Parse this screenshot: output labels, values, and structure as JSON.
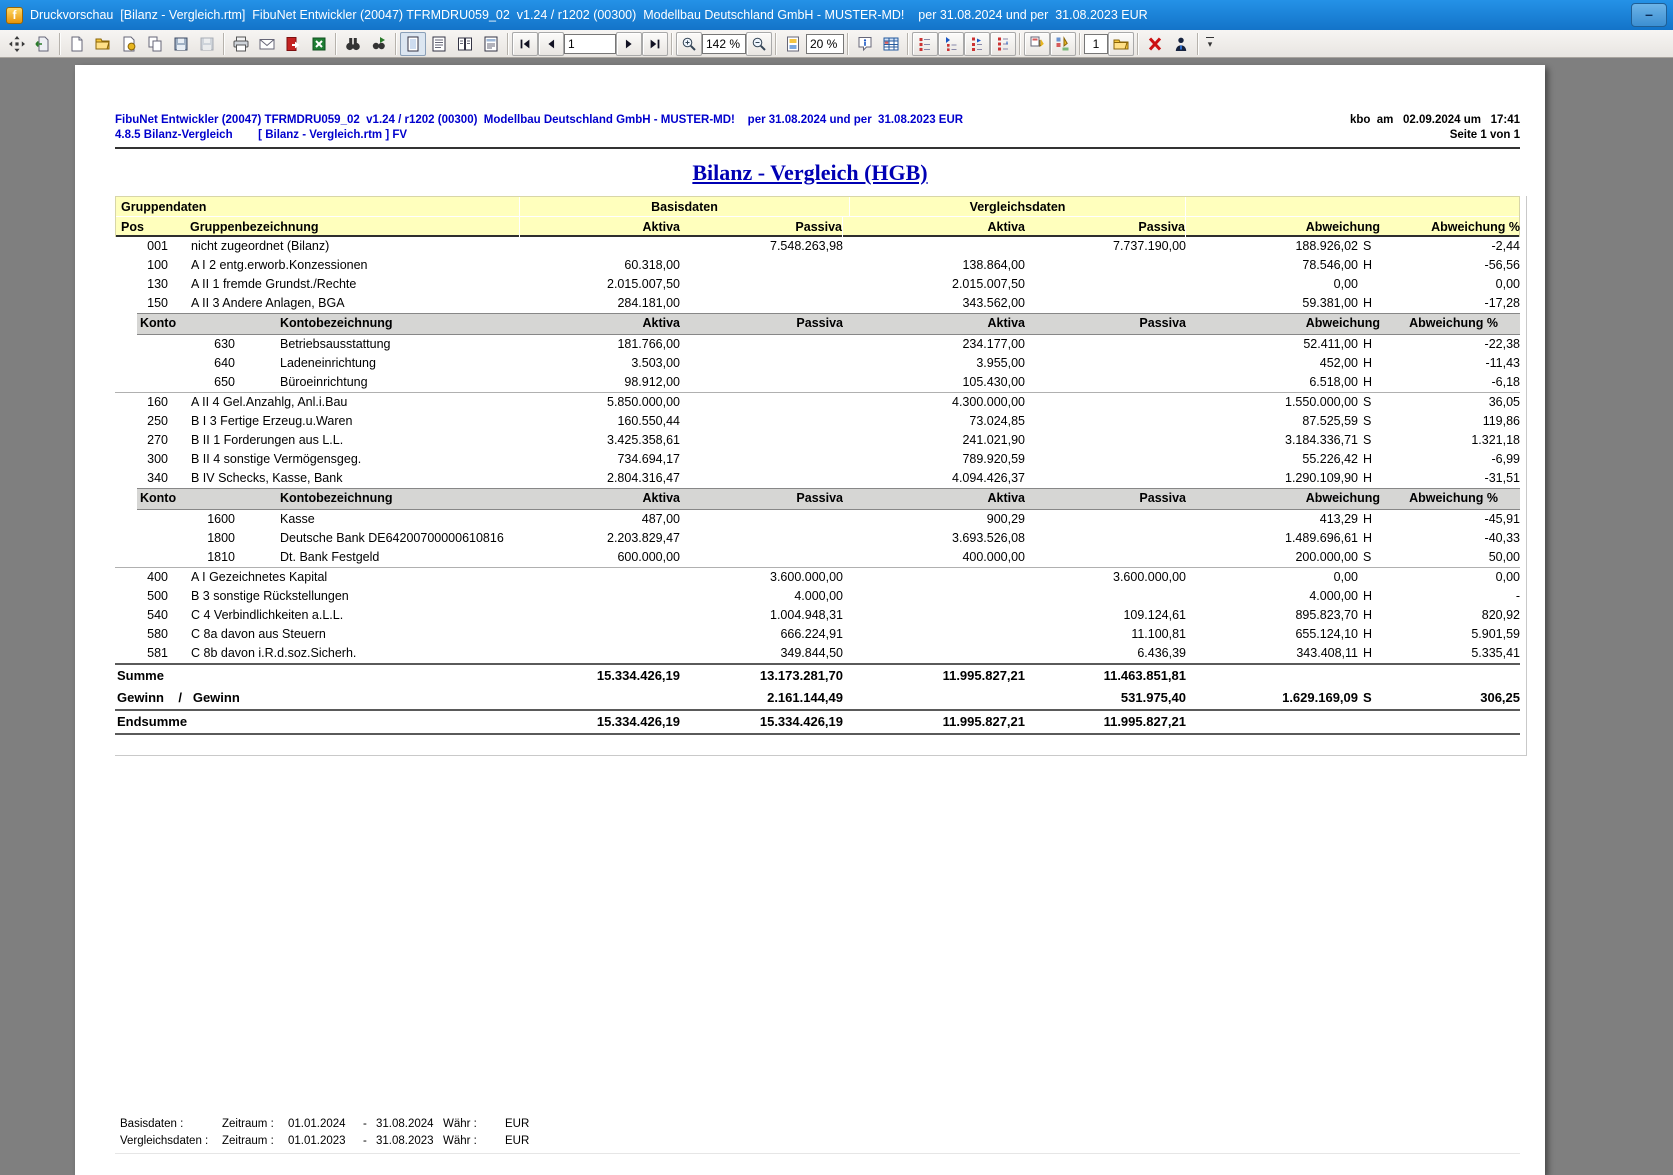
{
  "window": {
    "title": "Druckvorschau  [Bilanz - Vergleich.rtm]  FibuNet Entwickler (20047) TFRMDRU059_02  v1.24 / r1202 (00300)  Modellbau Deutschland GmbH - MUSTER-MD!    per 31.08.2024 und per  31.08.2023 EUR",
    "app_icon_letter": "f",
    "minimize_label": "–"
  },
  "toolbar": {
    "page_input": "1",
    "zoom_value": "142 %",
    "thumb_zoom_value": "20 %",
    "copies_input": "1"
  },
  "colors": {
    "titlebar_blue": "#1982d8",
    "band_yellow": "#ffffbd",
    "konto_gray": "#d6d6d4",
    "header_blue": "#0000cd",
    "title_navy": "#0000b4",
    "excel_green": "#1e7e34",
    "close_red": "#cc1111"
  },
  "report": {
    "header": {
      "line1_left": "FibuNet Entwickler (20047) TFRMDRU059_02  v1.24 / r1202 (00300)  Modellbau Deutschland GmbH - MUSTER-MD!    per 31.08.2024 und per  31.08.2023 EUR",
      "line1_right": "kbo  am   02.09.2024 um   17:41",
      "line2_left": "4.8.5 Bilanz-Vergleich        [ Bilanz - Vergleich.rtm ] FV",
      "line2_right": "Seite 1 von 1"
    },
    "title": "Bilanz - Vergleich (HGB)"
  },
  "table": {
    "band1": {
      "gruppendaten": "Gruppendaten",
      "basisdaten": "Basisdaten",
      "vergleichsdaten": "Vergleichsdaten"
    },
    "band2": {
      "pos": "Pos",
      "bez": "Gruppenbezeichnung",
      "aktiva": "Aktiva",
      "passiva": "Passiva",
      "aktiva2": "Aktiva",
      "passiva2": "Passiva",
      "abw": "Abweichung",
      "abwp": "Abweichung %"
    },
    "konto_header": {
      "konto": "Konto",
      "bez": "Kontobezeichnung",
      "aktiva": "Aktiva",
      "passiva": "Passiva",
      "aktiva2": "Aktiva",
      "passiva2": "Passiva",
      "abw": "Abweichung",
      "abwp": "Abweichung %"
    },
    "rows": [
      {
        "type": "group",
        "pos": "001",
        "name": "nicht zugeordnet (Bilanz)",
        "ba": "",
        "bp": "7.548.263,98",
        "va": "",
        "vp": "7.737.190,00",
        "abw": "188.926,02",
        "sfx": "S",
        "pct": "-2,44"
      },
      {
        "type": "group",
        "pos": "100",
        "name": "A I 2 entg.erworb.Konzessionen",
        "ba": "60.318,00",
        "bp": "",
        "va": "138.864,00",
        "vp": "",
        "abw": "78.546,00",
        "sfx": "H",
        "pct": "-56,56"
      },
      {
        "type": "group",
        "pos": "130",
        "name": "A II 1 fremde Grundst./Rechte",
        "ba": "2.015.007,50",
        "bp": "",
        "va": "2.015.007,50",
        "vp": "",
        "abw": "0,00",
        "sfx": "",
        "pct": "0,00"
      },
      {
        "type": "group",
        "pos": "150",
        "name": "A II 3 Andere Anlagen, BGA",
        "ba": "284.181,00",
        "bp": "",
        "va": "343.562,00",
        "vp": "",
        "abw": "59.381,00",
        "sfx": "H",
        "pct": "-17,28"
      },
      {
        "type": "konto_header"
      },
      {
        "type": "konto",
        "pos": "630",
        "name": "Betriebsausstattung",
        "ba": "181.766,00",
        "bp": "",
        "va": "234.177,00",
        "vp": "",
        "abw": "52.411,00",
        "sfx": "H",
        "pct": "-22,38"
      },
      {
        "type": "konto",
        "pos": "640",
        "name": "Ladeneinrichtung",
        "ba": "3.503,00",
        "bp": "",
        "va": "3.955,00",
        "vp": "",
        "abw": "452,00",
        "sfx": "H",
        "pct": "-11,43"
      },
      {
        "type": "konto",
        "pos": "650",
        "name": "Büroeinrichtung",
        "ba": "98.912,00",
        "bp": "",
        "va": "105.430,00",
        "vp": "",
        "abw": "6.518,00",
        "sfx": "H",
        "pct": "-6,18"
      },
      {
        "type": "rule",
        "style": "thin"
      },
      {
        "type": "group",
        "pos": "160",
        "name": "A II 4 Gel.Anzahlg, Anl.i.Bau",
        "ba": "5.850.000,00",
        "bp": "",
        "va": "4.300.000,00",
        "vp": "",
        "abw": "1.550.000,00",
        "sfx": "S",
        "pct": "36,05"
      },
      {
        "type": "group",
        "pos": "250",
        "name": "B I 3 Fertige Erzeug.u.Waren",
        "ba": "160.550,44",
        "bp": "",
        "va": "73.024,85",
        "vp": "",
        "abw": "87.525,59",
        "sfx": "S",
        "pct": "119,86"
      },
      {
        "type": "group",
        "pos": "270",
        "name": "B II 1 Forderungen aus L.L.",
        "ba": "3.425.358,61",
        "bp": "",
        "va": "241.021,90",
        "vp": "",
        "abw": "3.184.336,71",
        "sfx": "S",
        "pct": "1.321,18"
      },
      {
        "type": "group",
        "pos": "300",
        "name": "B II 4 sonstige Vermögensgeg.",
        "ba": "734.694,17",
        "bp": "",
        "va": "789.920,59",
        "vp": "",
        "abw": "55.226,42",
        "sfx": "H",
        "pct": "-6,99"
      },
      {
        "type": "group",
        "pos": "340",
        "name": "B IV Schecks, Kasse, Bank",
        "ba": "2.804.316,47",
        "bp": "",
        "va": "4.094.426,37",
        "vp": "",
        "abw": "1.290.109,90",
        "sfx": "H",
        "pct": "-31,51"
      },
      {
        "type": "konto_header"
      },
      {
        "type": "konto",
        "pos": "1600",
        "name": "Kasse",
        "ba": "487,00",
        "bp": "",
        "va": "900,29",
        "vp": "",
        "abw": "413,29",
        "sfx": "H",
        "pct": "-45,91"
      },
      {
        "type": "konto",
        "pos": "1800",
        "name": "Deutsche Bank DE64200700000610816",
        "ba": "2.203.829,47",
        "bp": "",
        "va": "3.693.526,08",
        "vp": "",
        "abw": "1.489.696,61",
        "sfx": "H",
        "pct": "-40,33"
      },
      {
        "type": "konto",
        "pos": "1810",
        "name": "Dt. Bank Festgeld",
        "ba": "600.000,00",
        "bp": "",
        "va": "400.000,00",
        "vp": "",
        "abw": "200.000,00",
        "sfx": "S",
        "pct": "50,00"
      },
      {
        "type": "rule",
        "style": "thin"
      },
      {
        "type": "group",
        "pos": "400",
        "name": "A I Gezeichnetes Kapital",
        "ba": "",
        "bp": "3.600.000,00",
        "va": "",
        "vp": "3.600.000,00",
        "abw": "0,00",
        "sfx": "",
        "pct": "0,00"
      },
      {
        "type": "group",
        "pos": "500",
        "name": "B 3 sonstige Rückstellungen",
        "ba": "",
        "bp": "4.000,00",
        "va": "",
        "vp": "",
        "abw": "4.000,00",
        "sfx": "H",
        "pct": "-"
      },
      {
        "type": "group",
        "pos": "540",
        "name": "C 4 Verbindlichkeiten a.L.L.",
        "ba": "",
        "bp": "1.004.948,31",
        "va": "",
        "vp": "109.124,61",
        "abw": "895.823,70",
        "sfx": "H",
        "pct": "820,92"
      },
      {
        "type": "group",
        "pos": "580",
        "name": "C 8a davon aus Steuern",
        "ba": "",
        "bp": "666.224,91",
        "va": "",
        "vp": "11.100,81",
        "abw": "655.124,10",
        "sfx": "H",
        "pct": "5.901,59"
      },
      {
        "type": "group",
        "pos": "581",
        "name": "C 8b davon i.R.d.soz.Sicherh.",
        "ba": "",
        "bp": "349.844,50",
        "va": "",
        "vp": "6.436,39",
        "abw": "343.408,11",
        "sfx": "H",
        "pct": "5.335,41"
      },
      {
        "type": "rule",
        "style": "dark"
      },
      {
        "type": "summary",
        "label": "Summe",
        "ba": "15.334.426,19",
        "bp": "13.173.281,70",
        "va": "11.995.827,21",
        "vp": "11.463.851,81",
        "abw": "",
        "sfx": "",
        "pct": ""
      },
      {
        "type": "summary",
        "label": "Gewinn    /   Gewinn",
        "ba": "",
        "bp": "2.161.144,49",
        "va": "",
        "vp": "531.975,40",
        "abw": "1.629.169,09",
        "sfx": "S",
        "pct": "306,25"
      },
      {
        "type": "rule",
        "style": "dark"
      },
      {
        "type": "summary",
        "label": "Endsumme",
        "ba": "15.334.426,19",
        "bp": "15.334.426,19",
        "va": "11.995.827,21",
        "vp": "11.995.827,21",
        "abw": "",
        "sfx": "",
        "pct": ""
      },
      {
        "type": "rule",
        "style": "dark"
      }
    ]
  },
  "footer": {
    "rows": [
      {
        "label": "Basisdaten :",
        "zeitraum_label": "Zeitraum :",
        "from": "01.01.2024",
        "dash": "-",
        "to": "31.08.2024",
        "waehr_label": "Währ :",
        "currency": "EUR"
      },
      {
        "label": "Vergleichsdaten :",
        "zeitraum_label": "Zeitraum :",
        "from": "01.01.2023",
        "dash": "-",
        "to": "31.08.2023",
        "waehr_label": "Währ :",
        "currency": "EUR"
      }
    ]
  }
}
